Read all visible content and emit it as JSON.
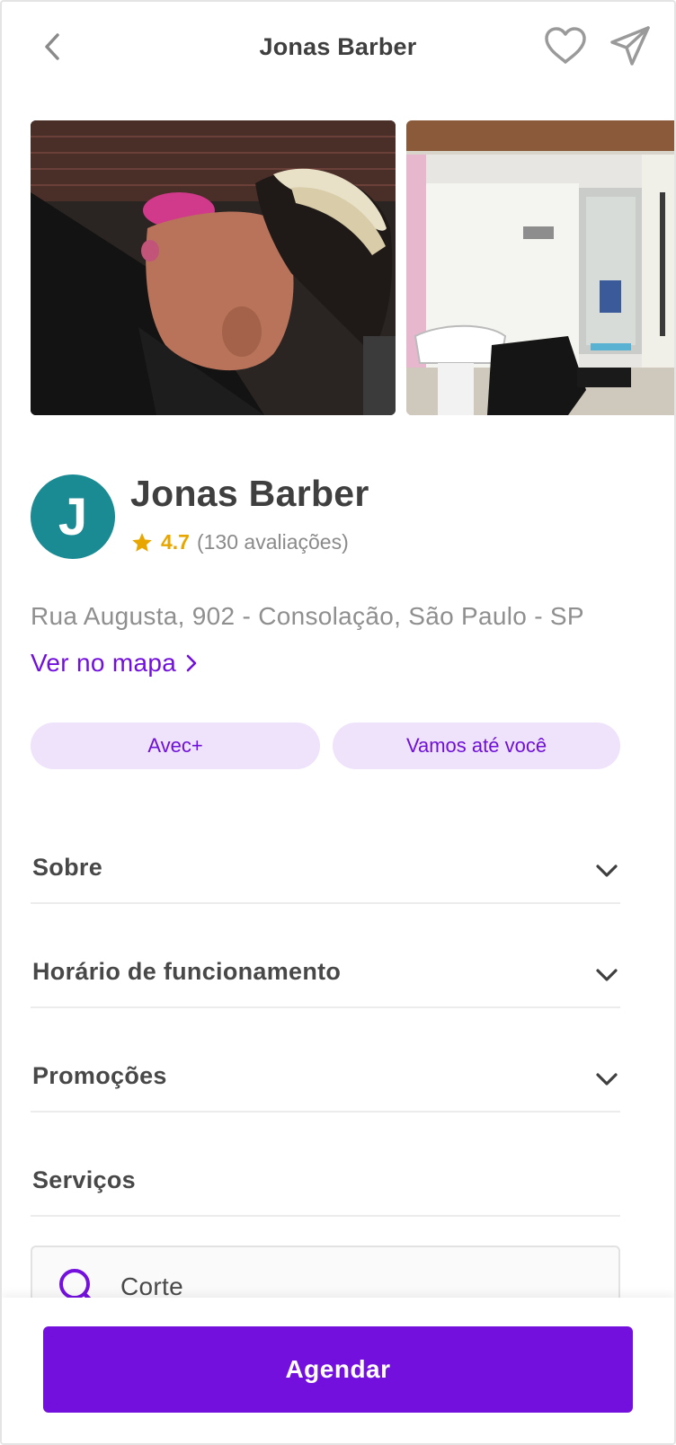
{
  "header": {
    "title": "Jonas Barber",
    "back_icon": "chevron-left-icon",
    "favorite_icon": "heart-icon",
    "share_icon": "send-icon"
  },
  "gallery": {
    "photos": [
      "haircut-photo",
      "salon-interior-photo"
    ]
  },
  "profile": {
    "avatar_letter": "J",
    "avatar_color": "#1a8a93",
    "name": "Jonas Barber",
    "rating": "4.7",
    "reviews": "(130 avaliações)",
    "address": "Rua Augusta, 902 - Consolação, São Paulo - SP",
    "map_link": "Ver no mapa"
  },
  "tags": [
    "Avec+",
    "Vamos até você"
  ],
  "sections": [
    {
      "label": "Sobre"
    },
    {
      "label": "Horário de funcionamento"
    },
    {
      "label": "Promoções"
    },
    {
      "label": "Serviços"
    }
  ],
  "search": {
    "value": "Corte"
  },
  "footer": {
    "cta_label": "Agendar"
  },
  "colors": {
    "primary": "#7410de",
    "tag_bg": "#efe3fb",
    "star": "#e8a700"
  }
}
